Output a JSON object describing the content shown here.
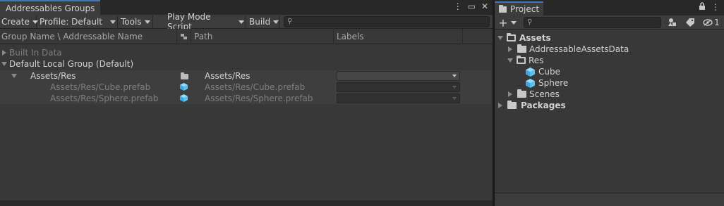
{
  "left": {
    "tab_title": "Addressables Groups",
    "toolbar": {
      "create": "Create",
      "profile": "Profile: Default",
      "tools": "Tools",
      "play_mode": "Play Mode Script",
      "build": "Build"
    },
    "columns": {
      "name": "Group Name \\ Addressable Name",
      "path": "Path",
      "labels": "Labels"
    },
    "rows": {
      "built_in": "Built In Data",
      "default_group": "Default Local Group (Default)",
      "res_name": "Assets/Res",
      "res_path": "Assets/Res",
      "cube_name": "Assets/Res/Cube.prefab",
      "cube_path": "Assets/Res/Cube.prefab",
      "sphere_name": "Assets/Res/Sphere.prefab",
      "sphere_path": "Assets/Res/Sphere.prefab"
    }
  },
  "right": {
    "tab_title": "Project",
    "toolbar": {
      "add": "+",
      "hidden_count": "1"
    },
    "tree": {
      "assets": "Assets",
      "aad": "AddressableAssetsData",
      "res": "Res",
      "cube": "Cube",
      "sphere": "Sphere",
      "scenes": "Scenes",
      "packages": "Packages"
    }
  },
  "colors": {
    "accent": "#3a79bb",
    "prefab_icon": "#5cc3f0",
    "panel_bg": "#383838"
  },
  "icons": [
    "kebab-menu-icon",
    "maximize-icon",
    "close-icon",
    "search-icon",
    "folder-icon",
    "prefab-cube-icon",
    "lock-icon",
    "filter-by-type-icon",
    "label-icon",
    "hidden-packages-icon"
  ]
}
